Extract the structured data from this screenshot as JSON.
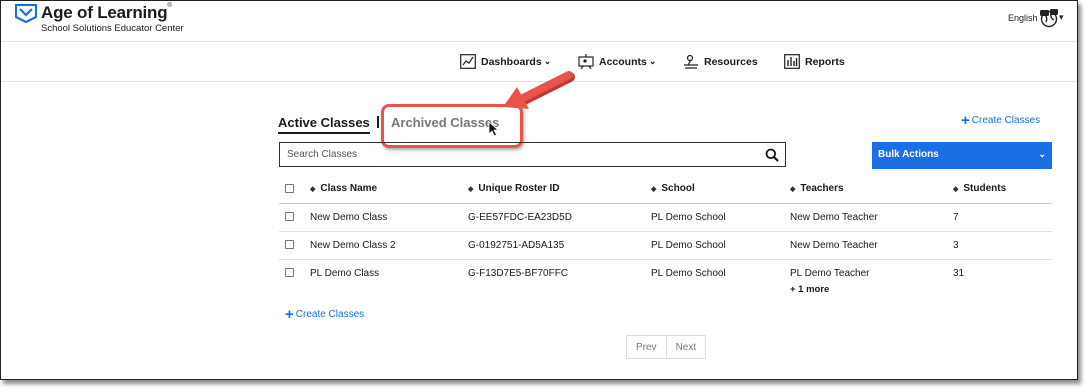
{
  "header": {
    "brand": "Age of Learning",
    "brand_mark": "®",
    "subtitle": "School Solutions Educator Center",
    "language": "English"
  },
  "nav": {
    "items": [
      {
        "label": "Dashboards",
        "icon": "line-chart-icon",
        "has_dropdown": true
      },
      {
        "label": "Accounts",
        "icon": "easel-icon",
        "has_dropdown": true
      },
      {
        "label": "Resources",
        "icon": "lamp-icon",
        "has_dropdown": false
      },
      {
        "label": "Reports",
        "icon": "bar-chart-icon",
        "has_dropdown": false
      }
    ],
    "chevron": "⌄"
  },
  "tabs": {
    "active": "Active Classes",
    "archived": "Archived Classes"
  },
  "actions": {
    "create_label": "Create Classes",
    "bulk_label": "Bulk Actions"
  },
  "search": {
    "placeholder": "Search Classes",
    "value": ""
  },
  "table": {
    "headers": [
      "Class Name",
      "Unique Roster ID",
      "School",
      "Teachers",
      "Students"
    ],
    "sort_glyph": "◆",
    "rows": [
      {
        "class_name": "New Demo Class",
        "roster_id": "G-EE57FDC-EA23D5D",
        "school": "PL Demo School",
        "teachers": "New Demo Teacher",
        "more": "",
        "students": "7"
      },
      {
        "class_name": "New Demo Class 2",
        "roster_id": "G-0192751-AD5A135",
        "school": "PL Demo School",
        "teachers": "New Demo Teacher",
        "more": "",
        "students": "3"
      },
      {
        "class_name": "PL Demo Class",
        "roster_id": "G-F13D7E5-BF70FFC",
        "school": "PL Demo School",
        "teachers": "PL Demo Teacher",
        "more": "+ 1 more",
        "students": "31"
      }
    ]
  },
  "pagination": {
    "prev": "Prev",
    "next": "Next"
  },
  "colors": {
    "accent": "#1a6fe5",
    "link": "#1a6fd8",
    "annotation": "#e8544a"
  }
}
